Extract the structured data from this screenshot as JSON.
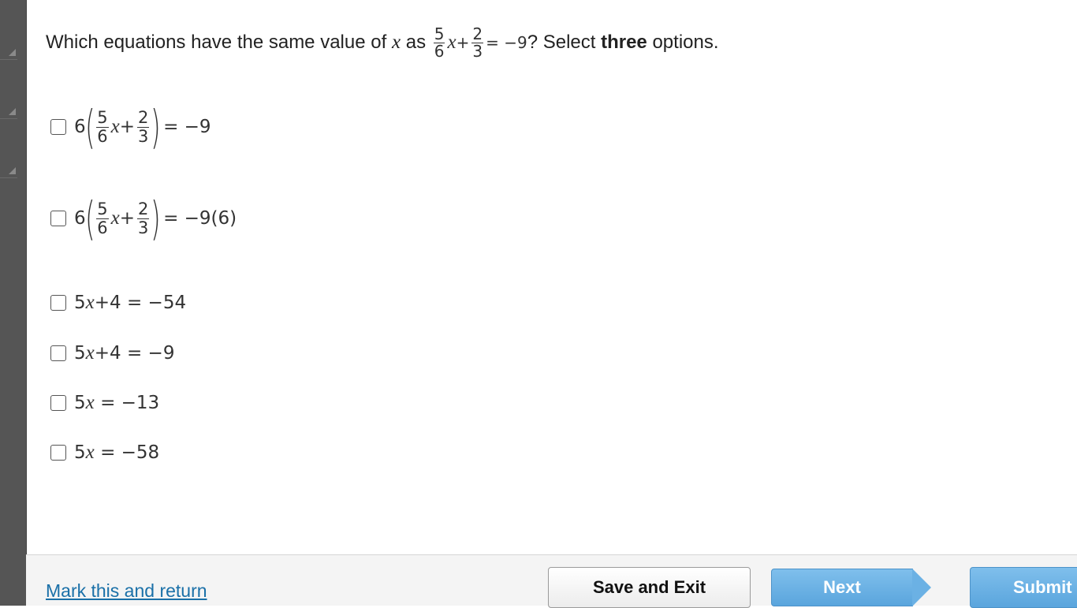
{
  "question": {
    "prefix": "Which equations have the same value of",
    "var": "x",
    "as": "as",
    "eq_num1": "5",
    "eq_den1": "6",
    "eq_x": "x",
    "eq_plus": "+",
    "eq_num2": "2",
    "eq_den2": "3",
    "eq_rhs": "= −9",
    "suffix_q": "? Select",
    "suffix_bold": "three",
    "suffix_end": "options."
  },
  "options": [
    {
      "coef": "6",
      "n1": "5",
      "d1": "6",
      "x": "x",
      "plus": "+",
      "n2": "2",
      "d2": "3",
      "rhs": "= −9"
    },
    {
      "coef": "6",
      "n1": "5",
      "d1": "6",
      "x": "x",
      "plus": "+",
      "n2": "2",
      "d2": "3",
      "rhs": "= −9(6)"
    },
    {
      "lhs_a": "5",
      "x": "x",
      "lhs_b": "+4",
      "rhs": "= −54"
    },
    {
      "lhs_a": "5",
      "x": "x",
      "lhs_b": "+4",
      "rhs": "= −9"
    },
    {
      "lhs_a": "5",
      "x": "x",
      "lhs_b": "",
      "rhs": "= −13"
    },
    {
      "lhs_a": "5",
      "x": "x",
      "lhs_b": "",
      "rhs": "= −58"
    }
  ],
  "footer": {
    "mark_link": "Mark this and return",
    "save_exit": "Save and Exit",
    "next": "Next",
    "submit": "Submit"
  },
  "colors": {
    "rail": "#555555",
    "link": "#1a70a8",
    "primary_button": "#5aa5dd"
  }
}
